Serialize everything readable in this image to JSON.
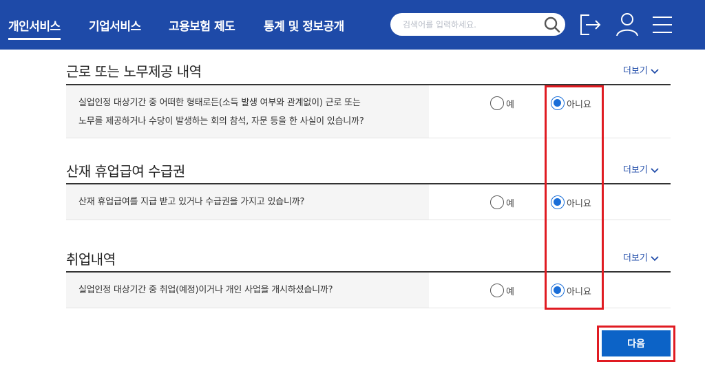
{
  "header": {
    "nav": [
      {
        "label": "개인서비스"
      },
      {
        "label": "기업서비스"
      },
      {
        "label": "고용보험 제도"
      },
      {
        "label": "통계 및 정보공개"
      }
    ],
    "search_placeholder": "검색어를 입력하세요.",
    "icons": [
      "search-icon",
      "logout-icon",
      "user-icon",
      "menu-icon"
    ],
    "brand_color": "#1e4aa8"
  },
  "sections": [
    {
      "title": "근로 또는 노무제공 내역",
      "more": "더보기",
      "question_lines": [
        "실업인정 대상기간 중 어떠한 형태로든(소득 발생 여부와 관계없이) 근로 또는",
        "노무를 제공하거나 수당이 발생하는 회의 참석, 자문 등을 한 사실이 있습니까?"
      ],
      "yes": "예",
      "no": "아니요",
      "selected": "no"
    },
    {
      "title": "산재 휴업급여 수급권",
      "more": "더보기",
      "question_lines": [
        "산재 휴업급여를 지급 받고 있거나 수급권을 가지고 있습니까?"
      ],
      "yes": "예",
      "no": "아니요",
      "selected": "no"
    },
    {
      "title": "취업내역",
      "more": "더보기",
      "question_lines": [
        "실업인정 대상기간 중 취업(예정)이거나 개인 사업을 개시하셨습니까?"
      ],
      "yes": "예",
      "no": "아니요",
      "selected": "no"
    }
  ],
  "next_button": "다음",
  "highlight_color": "#e01b22"
}
